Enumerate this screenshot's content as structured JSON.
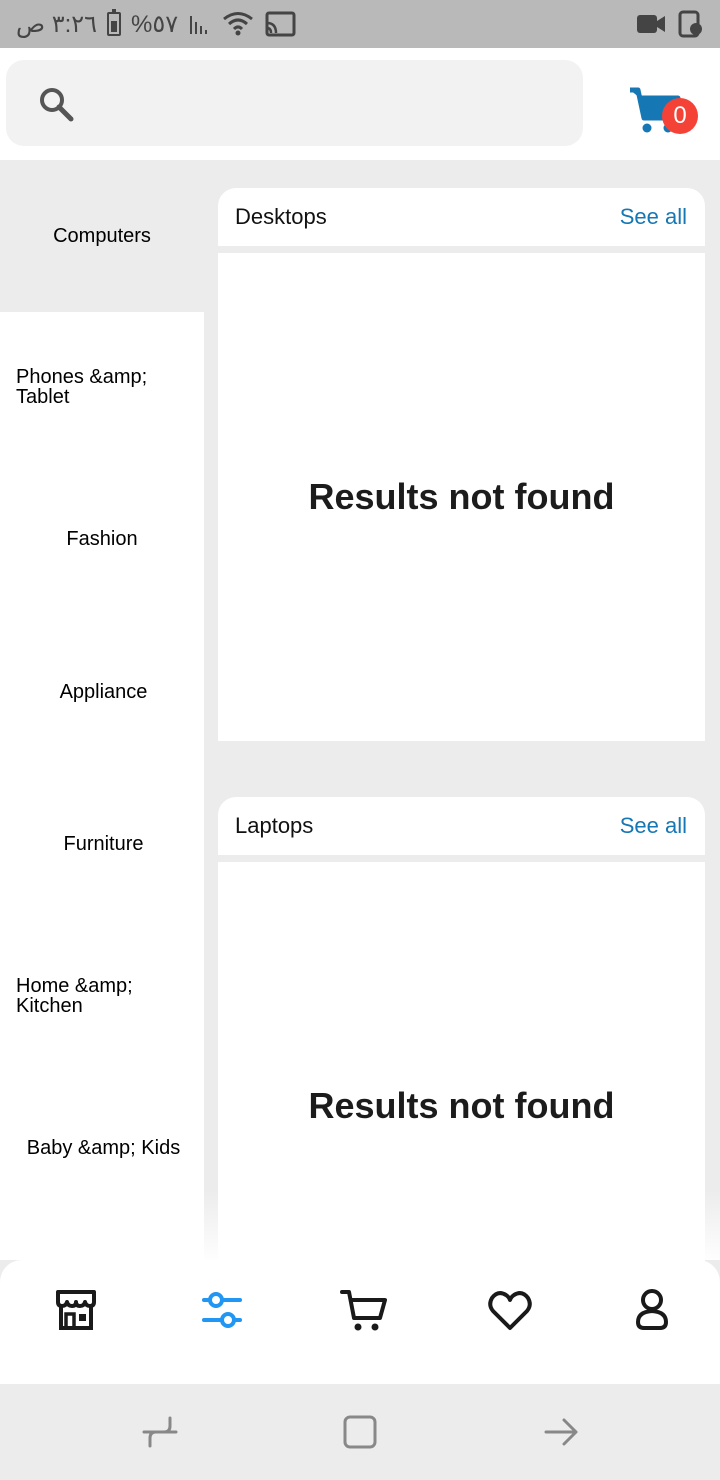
{
  "status_bar": {
    "time": "٣:٢٦ ص",
    "battery": "%٥٧"
  },
  "search": {
    "placeholder": "",
    "value": ""
  },
  "cart": {
    "badge_count": "0"
  },
  "colors": {
    "accent": "#1677b5",
    "badge": "#f44336",
    "selected_background": "#ececec"
  },
  "categories": [
    {
      "label": "Computers",
      "selected": true
    },
    {
      "label": "Phones &amp; Tablet",
      "selected": false
    },
    {
      "label": "Fashion",
      "selected": false
    },
    {
      "label": "Appliance",
      "selected": false
    },
    {
      "label": "Furniture",
      "selected": false
    },
    {
      "label": "Home &amp; Kitchen",
      "selected": false
    },
    {
      "label": "Baby &amp; Kids",
      "selected": false
    }
  ],
  "sections": [
    {
      "title": "Desktops",
      "see_all": "See all",
      "empty_text": "Results not found"
    },
    {
      "title": "Laptops",
      "see_all": "See all",
      "empty_text": "Results not found"
    }
  ],
  "bottom_nav": {
    "items": [
      {
        "icon": "store-icon",
        "active": false
      },
      {
        "icon": "filter-sliders-icon",
        "active": true
      },
      {
        "icon": "cart-icon",
        "active": false
      },
      {
        "icon": "heart-icon",
        "active": false
      },
      {
        "icon": "profile-icon",
        "active": false
      }
    ]
  },
  "system_nav": {
    "items": [
      "recents-icon",
      "home-icon",
      "back-icon"
    ]
  }
}
